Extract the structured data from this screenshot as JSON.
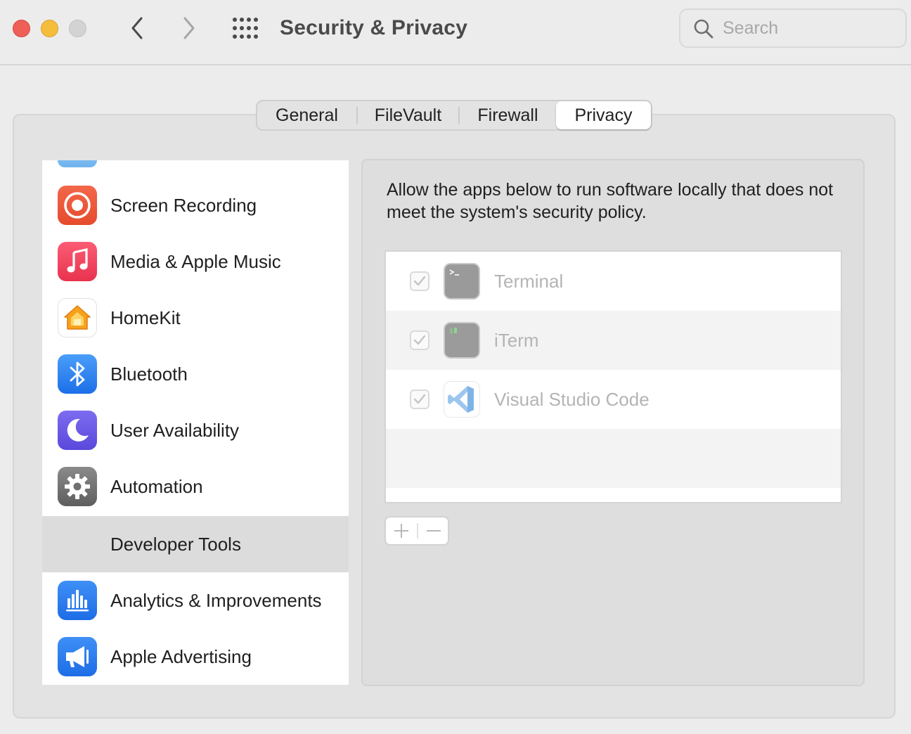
{
  "window": {
    "title": "Security & Privacy",
    "traffic_lights": [
      "close",
      "minimize",
      "zoom"
    ]
  },
  "toolbar": {
    "back_icon": "chevron-left-icon",
    "forward_icon": "chevron-right-icon",
    "show_all_icon": "grid-icon"
  },
  "search": {
    "placeholder": "Search",
    "value": ""
  },
  "tabs": [
    {
      "label": "General",
      "selected": false
    },
    {
      "label": "FileVault",
      "selected": false
    },
    {
      "label": "Firewall",
      "selected": false
    },
    {
      "label": "Privacy",
      "selected": true
    }
  ],
  "sidebar": {
    "items": [
      {
        "label": "Screen Recording",
        "icon": "screen-recording-icon",
        "selected": false
      },
      {
        "label": "Media & Apple Music",
        "icon": "music-note-icon",
        "selected": false
      },
      {
        "label": "HomeKit",
        "icon": "home-icon",
        "selected": false
      },
      {
        "label": "Bluetooth",
        "icon": "bluetooth-icon",
        "selected": false
      },
      {
        "label": "User Availability",
        "icon": "moon-icon",
        "selected": false
      },
      {
        "label": "Automation",
        "icon": "gear-icon",
        "selected": false
      },
      {
        "label": "Developer Tools",
        "icon": "",
        "selected": true
      },
      {
        "label": "Analytics & Improvements",
        "icon": "analytics-chart-icon",
        "selected": false
      },
      {
        "label": "Apple Advertising",
        "icon": "megaphone-icon",
        "selected": false
      }
    ]
  },
  "content": {
    "description": "Allow the apps below to run software locally that does not meet the system's security policy.",
    "apps": [
      {
        "name": "Terminal",
        "checked": true,
        "icon": "terminal-icon"
      },
      {
        "name": "iTerm",
        "checked": true,
        "icon": "iterm-icon"
      },
      {
        "name": "Visual Studio Code",
        "checked": true,
        "icon": "vscode-icon"
      }
    ],
    "add_label": "+",
    "remove_label": "−"
  },
  "colors": {
    "window_bg": "#ececec",
    "panel_bg": "#e3e3e3",
    "selected_row": "#dcdcdc",
    "close": "#ee5f58",
    "minimize": "#f5bd3c",
    "zoom_inactive": "#d3d3d3",
    "accent_blue": "#2f7cf6"
  }
}
